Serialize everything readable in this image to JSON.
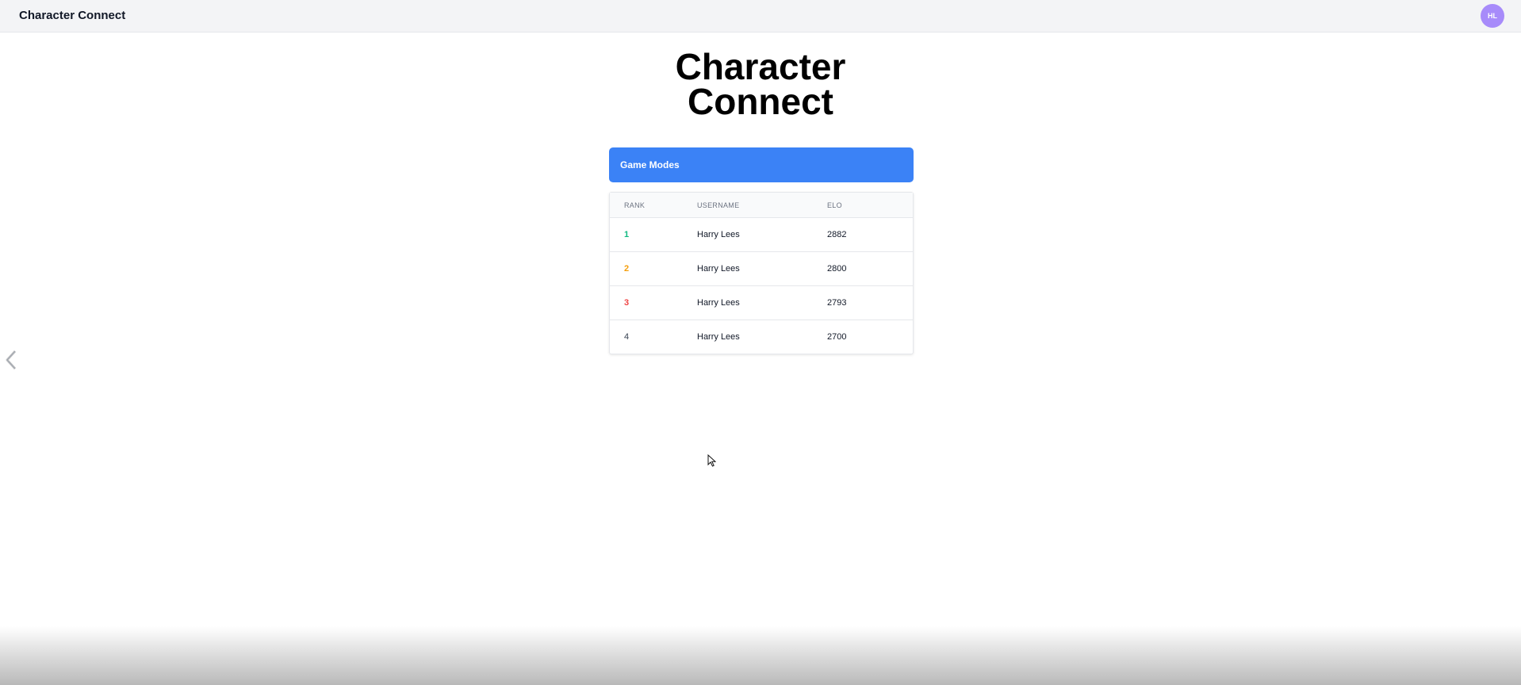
{
  "navbar": {
    "brand": "Character Connect",
    "avatar_initials": "HL"
  },
  "hero": {
    "title_line1": "Character",
    "title_line2": "Connect"
  },
  "game_modes_button": {
    "label": "Game Modes",
    "color": "#3b82f6"
  },
  "leaderboard": {
    "columns": [
      "RANK",
      "USERNAME",
      "ELO"
    ],
    "rows": [
      {
        "rank": "1",
        "username": "Harry Lees",
        "elo": "2882",
        "rank_color": "#10b981"
      },
      {
        "rank": "2",
        "username": "Harry Lees",
        "elo": "2800",
        "rank_color": "#f59e0b"
      },
      {
        "rank": "3",
        "username": "Harry Lees",
        "elo": "2793",
        "rank_color": "#ef4444"
      },
      {
        "rank": "4",
        "username": "Harry Lees",
        "elo": "2700",
        "rank_color": "#374151"
      }
    ]
  },
  "icons": {
    "prev": "chevron-left-icon"
  }
}
